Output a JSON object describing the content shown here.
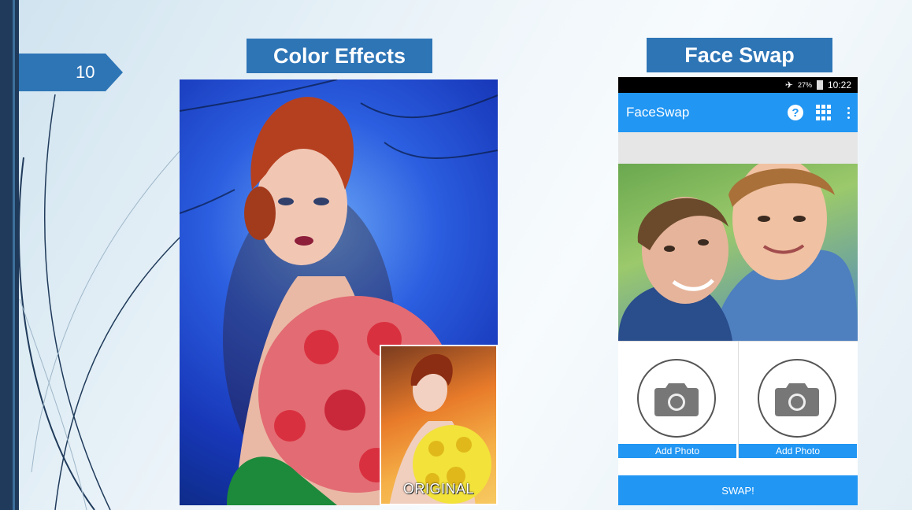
{
  "slide": {
    "number": "10"
  },
  "left_panel": {
    "title": "Color Effects",
    "inset_label": "ORIGINAL"
  },
  "right_panel": {
    "title": "Face Swap",
    "status": {
      "battery_pct": "27%",
      "time": "10:22"
    },
    "app_title": "FaceSwap",
    "help_glyph": "?",
    "add_photo_1": "Add Photo",
    "add_photo_2": "Add Photo",
    "swap_button": "SWAP!"
  },
  "colors": {
    "accent": "#2e75b6",
    "app_blue": "#2196f3",
    "sidebar": "#1f3a5a"
  },
  "icons": [
    "airplane-icon",
    "battery-icon",
    "help-icon",
    "apps-grid-icon",
    "overflow-menu-icon",
    "camera-icon"
  ]
}
